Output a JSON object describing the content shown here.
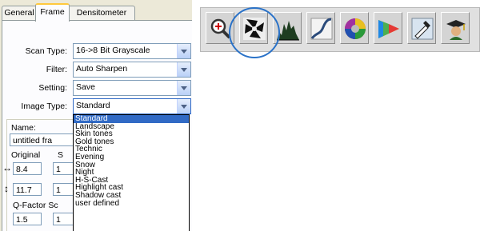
{
  "tabs": [
    {
      "label": "General"
    },
    {
      "label": "Frame"
    },
    {
      "label": "Densitometer"
    }
  ],
  "form": {
    "scan_type": {
      "label": "Scan Type:",
      "value": "16->8 Bit Grayscale"
    },
    "filter": {
      "label": "Filter:",
      "value": "Auto Sharpen"
    },
    "setting": {
      "label": "Setting:",
      "value": "Save"
    },
    "image_type": {
      "label": "Image Type:",
      "value": "Standard"
    }
  },
  "frame": {
    "name_label": "Name:",
    "name_value": "untitled fra",
    "original_label": "Original",
    "scale_label": "S",
    "width_value": "8.4",
    "width_scale": "1",
    "height_value": "11.7",
    "height_scale": "1",
    "qfactor_label": "Q-Factor Sc",
    "qfactor_value": "1.5",
    "qfactor_scale": "1"
  },
  "dropdown": {
    "items": [
      "Standard",
      "Landscape",
      "Skin tones",
      "Gold tones",
      "Technic",
      "Evening",
      "Snow",
      "Night",
      "H-S-Cast",
      "Highlight cast",
      "Shadow cast",
      "user defined"
    ],
    "selected_index": 0
  },
  "toolbar": {
    "buttons": [
      {
        "icon": "zoom-icon"
      },
      {
        "icon": "auto-adjust-icon"
      },
      {
        "icon": "histogram-icon"
      },
      {
        "icon": "gradation-icon"
      },
      {
        "icon": "color-balance-icon"
      },
      {
        "icon": "selective-color-icon"
      },
      {
        "icon": "pipette-icon"
      },
      {
        "icon": "expert-mode-icon"
      }
    ],
    "highlighted_index": 1,
    "highlight_color": "#2a72c8"
  }
}
